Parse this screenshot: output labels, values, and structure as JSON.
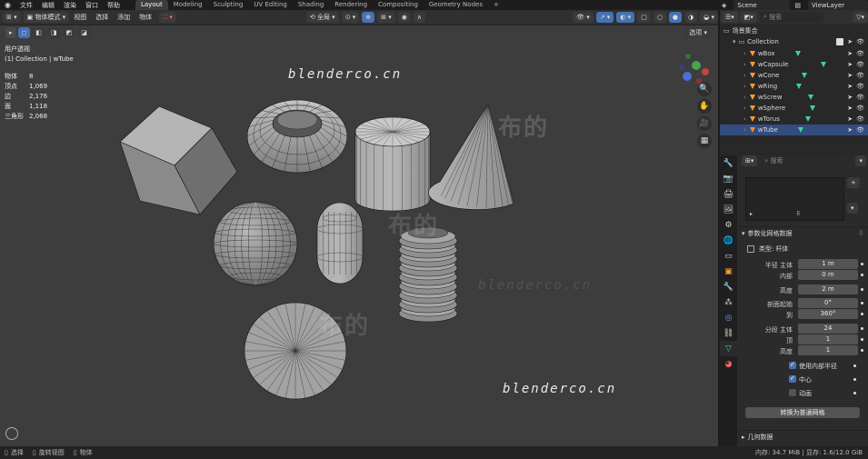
{
  "top_menu": {
    "items": [
      "文件",
      "编辑",
      "渲染",
      "窗口",
      "帮助"
    ]
  },
  "workspaces": {
    "tabs": [
      "Layout",
      "Modeling",
      "Sculpting",
      "UV Editing",
      "Shading",
      "Rendering",
      "Compositing",
      "Geometry Nodes"
    ],
    "active": "Layout",
    "add": "+"
  },
  "scene": {
    "scene_name": "Scene",
    "view_layer": "ViewLayer"
  },
  "viewport_header": {
    "mode": "物体模式",
    "menus": [
      "视图",
      "选择",
      "添加",
      "物体"
    ],
    "orientation": "全局",
    "options": "选项"
  },
  "viewport_info": {
    "view_name": "用户透视",
    "collection": "(1) Collection | wTube",
    "stats": [
      {
        "label": "物体",
        "value": "8"
      },
      {
        "label": "顶点",
        "value": "1,069"
      },
      {
        "label": "边",
        "value": "2,176"
      },
      {
        "label": "面",
        "value": "1,118"
      },
      {
        "label": "三角形",
        "value": "2,068"
      }
    ]
  },
  "watermarks": {
    "site": "blenderco.cn",
    "cn": "布的"
  },
  "outliner": {
    "search_placeholder": "搜索",
    "root": "场景集合",
    "collection": "Collection",
    "objects": [
      "wBox",
      "wCapsule",
      "wCone",
      "wRing",
      "wScrew",
      "wSphere",
      "wTorus",
      "wTube"
    ]
  },
  "properties": {
    "search_placeholder": "搜索",
    "panel_title": "参数化网格数据",
    "type_label": "类型:",
    "type_value": "杆体",
    "fields": [
      {
        "label": "半径 主体",
        "value": "1 m"
      },
      {
        "label": "内部",
        "value": "0 m"
      },
      {
        "label": "高度",
        "value": "2 m"
      },
      {
        "label": "剖面起始",
        "value": "0°"
      },
      {
        "label": "到",
        "value": "360°"
      },
      {
        "label": "分段 主体",
        "value": "24"
      },
      {
        "label": "顶",
        "value": "1"
      },
      {
        "label": "高度",
        "value": "1"
      }
    ],
    "checkboxes": [
      {
        "label": "使用内部半径",
        "checked": true
      },
      {
        "label": "中心",
        "checked": true
      },
      {
        "label": "动画",
        "checked": false
      }
    ],
    "convert_button": "转换为普通网格",
    "geometry_data": "几何数据"
  },
  "status_bar": {
    "items": [
      "选择",
      "旋转视图",
      "物体"
    ],
    "memory": "内存: 34.7 MiB | 显存: 1.6/12.0 GiB"
  },
  "colors": {
    "accent": "#4772b3",
    "object_orange": "#ff9c3a",
    "mesh_green": "#3fd19b",
    "selected": "#f28f28"
  }
}
